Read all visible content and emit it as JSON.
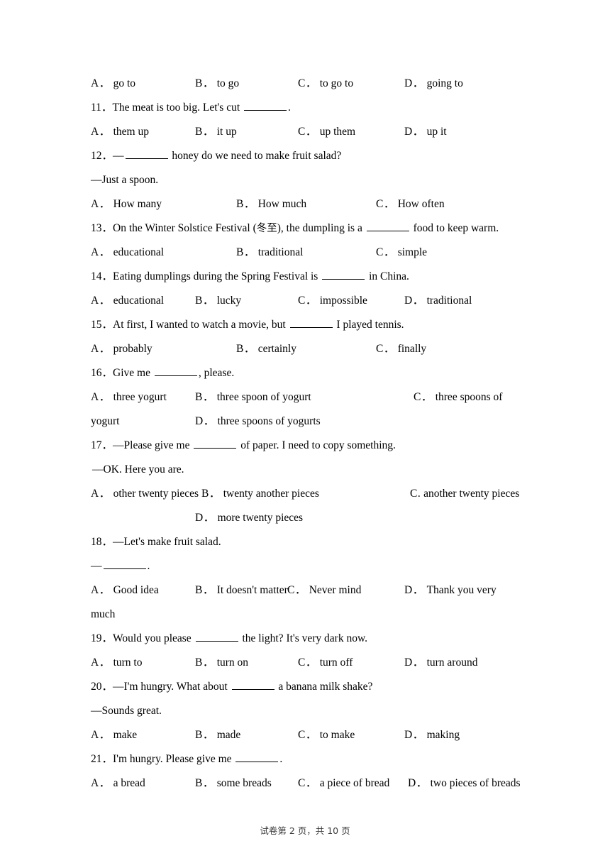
{
  "document": {
    "footer": "试卷第 2 页，共 10 页"
  },
  "questions": [
    {
      "id": "q10",
      "options": [
        {
          "label": "A．",
          "text": "go to"
        },
        {
          "label": "B．",
          "text": "to go"
        },
        {
          "label": "C．",
          "text": "to go to"
        },
        {
          "label": "D．",
          "text": "going to"
        }
      ]
    },
    {
      "id": "q11",
      "number": "11．",
      "stem_before": "The meat is too big. Let's cut ",
      "stem_after": ".",
      "options": [
        {
          "label": "A．",
          "text": "them up"
        },
        {
          "label": "B．",
          "text": "it up"
        },
        {
          "label": "C．",
          "text": "up them"
        },
        {
          "label": "D．",
          "text": "up it"
        }
      ]
    },
    {
      "id": "q12",
      "number": "12．",
      "stem_before": "—",
      "stem_after": " honey do we need to make fruit salad?",
      "dialog": "—Just a spoon.",
      "options": [
        {
          "label": "A．",
          "text": "How many"
        },
        {
          "label": "B．",
          "text": "How much"
        },
        {
          "label": "C．",
          "text": "How often"
        }
      ]
    },
    {
      "id": "q13",
      "number": "13．",
      "stem_before": "On the Winter Solstice Festival (",
      "stem_cn": "冬至",
      "stem_mid": "), the dumpling is a ",
      "stem_after": " food to keep warm.",
      "options": [
        {
          "label": "A．",
          "text": "educational"
        },
        {
          "label": "B．",
          "text": "traditional"
        },
        {
          "label": "C．",
          "text": "simple"
        }
      ]
    },
    {
      "id": "q14",
      "number": "14．",
      "stem_before": "Eating dumplings during the Spring Festival is ",
      "stem_after": " in China.",
      "options": [
        {
          "label": "A．",
          "text": "educational"
        },
        {
          "label": "B．",
          "text": "lucky"
        },
        {
          "label": "C．",
          "text": "impossible"
        },
        {
          "label": "D．",
          "text": "traditional"
        }
      ]
    },
    {
      "id": "q15",
      "number": "15．",
      "stem_before": "At first, I wanted to watch a movie, but ",
      "stem_after": " I played tennis.",
      "options": [
        {
          "label": "A．",
          "text": "probably"
        },
        {
          "label": "B．",
          "text": "certainly"
        },
        {
          "label": "C．",
          "text": "finally"
        }
      ]
    },
    {
      "id": "q16",
      "number": "16．",
      "stem_before": "Give me ",
      "stem_after": ", please.",
      "options": [
        {
          "label": "A．",
          "text": "three yogurt"
        },
        {
          "label": "B．",
          "text": "three spoon of yogurt"
        },
        {
          "label": "C．",
          "text": "three spoons of"
        },
        {
          "label": "C_wrap",
          "text": "yogurt"
        },
        {
          "label": "D．",
          "text": "three spoons of yogurts"
        }
      ]
    },
    {
      "id": "q17",
      "number": "17．",
      "stem_before": "—Please give me ",
      "stem_after": " of paper. I need to copy something.",
      "dialog": "—OK. Here you are.",
      "options": [
        {
          "label": "A．",
          "text": "other twenty pieces"
        },
        {
          "label": "B．",
          "text": "twenty another pieces"
        },
        {
          "label": "C.",
          "text": "another twenty pieces"
        },
        {
          "label": "D．",
          "text": "more twenty pieces"
        }
      ]
    },
    {
      "id": "q18",
      "number": "18．",
      "stem_before": "—Let's make fruit salad.",
      "dialog_before": "—",
      "dialog_after": ".",
      "options": [
        {
          "label": "A．",
          "text": "Good idea"
        },
        {
          "label": "B．",
          "text": "It doesn't matter"
        },
        {
          "label": "C．",
          "text": "Never mind"
        },
        {
          "label": "D．",
          "text": "Thank you very"
        },
        {
          "label": "D_wrap",
          "text": "much"
        }
      ]
    },
    {
      "id": "q19",
      "number": "19．",
      "stem_before": "Would you please ",
      "stem_after": " the light? It's very dark now.",
      "options": [
        {
          "label": "A．",
          "text": "turn to"
        },
        {
          "label": "B．",
          "text": "turn on"
        },
        {
          "label": "C．",
          "text": "turn off"
        },
        {
          "label": "D．",
          "text": "turn around"
        }
      ]
    },
    {
      "id": "q20",
      "number": "20．",
      "stem_before": "—I'm hungry. What about ",
      "stem_after": " a banana milk shake?",
      "dialog": "—Sounds great.",
      "options": [
        {
          "label": "A．",
          "text": "make"
        },
        {
          "label": "B．",
          "text": "made"
        },
        {
          "label": "C．",
          "text": "to make"
        },
        {
          "label": "D．",
          "text": "making"
        }
      ]
    },
    {
      "id": "q21",
      "number": "21．",
      "stem_before": "I'm hungry. Please give me ",
      "stem_after": ".",
      "options": [
        {
          "label": "A．",
          "text": "a bread"
        },
        {
          "label": "B．",
          "text": "some breads"
        },
        {
          "label": "C．",
          "text": "a piece of bread"
        },
        {
          "label": "D．",
          "text": "two pieces of breads"
        }
      ]
    }
  ]
}
